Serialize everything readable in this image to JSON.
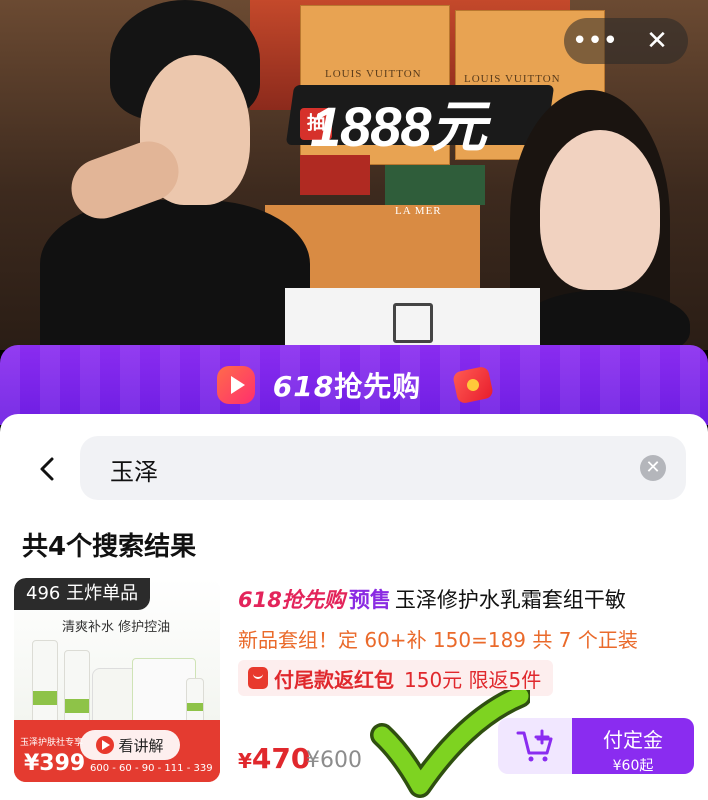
{
  "video": {
    "bag_brand": "LOUIS VUITTON",
    "prize_prefix": "抽",
    "prize_text": "1888元",
    "box_brand": "LA MER",
    "more_icon": "more-dots-icon",
    "close_icon": "close-icon"
  },
  "promo": {
    "title_num": "618",
    "title_text": "抢先购"
  },
  "search": {
    "query": "玉泽",
    "back_icon": "back-arrow-icon",
    "clear_icon": "clear-icon"
  },
  "results": {
    "count_label": "共4个搜索结果"
  },
  "product": {
    "image": {
      "tag": "496 王炸单品",
      "subtitle": "清爽补水  修护控油",
      "small_text": "玉泽护肤社专享",
      "price": "¥399",
      "steps": "600 - 60 - 90 - 111 - 339",
      "watch_label": "看讲解"
    },
    "title_618": "618抢先购",
    "title_presale": "预售",
    "title_name": "玉泽修护水乳霜套组干敏",
    "promo_line": "新品套组！定 60+补 150=189 共 7 个正装",
    "redpack_label": "付尾款返红包",
    "redpack_detail": "150元 限返5件",
    "price_currency": "¥",
    "price": "470",
    "original_price": "¥600",
    "buy_label": "付定金",
    "deposit": "¥60起"
  },
  "colors": {
    "accent_purple": "#8a2cf0",
    "price_red": "#e0282d",
    "promo_orange": "#ea6a2b",
    "check_green": "#7ed321"
  }
}
